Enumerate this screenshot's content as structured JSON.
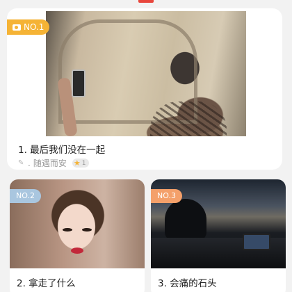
{
  "feed": {
    "featured": {
      "badge": "NO.1",
      "badge_icon": "camera-icon",
      "title": "1. 最后我们没在一起",
      "author": "随遇而安",
      "author_level": "1",
      "badge_color": "#f5b335"
    },
    "cards": [
      {
        "badge": "NO.2",
        "title": "2. 拿走了什么",
        "badge_color": "#a9c6df"
      },
      {
        "badge": "NO.3",
        "title": "3. 会痛的石头",
        "badge_color": "#f4a06a"
      }
    ]
  },
  "colors": {
    "accent": "#e8463c",
    "background": "#f2f2f2"
  }
}
